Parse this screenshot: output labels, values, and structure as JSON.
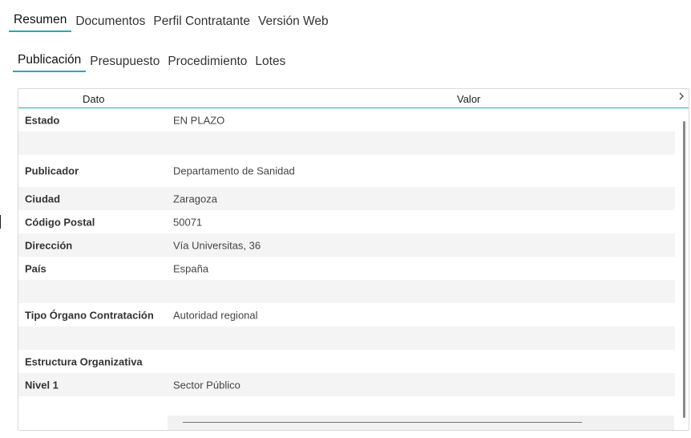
{
  "tabs_top": [
    "Resumen",
    "Documentos",
    "Perfil Contratante",
    "Versión Web"
  ],
  "tabs_sub": [
    "Publicación",
    "Presupuesto",
    "Procedimiento",
    "Lotes"
  ],
  "grid": {
    "header": {
      "col1": "Dato",
      "col2": "Valor"
    },
    "rows": [
      {
        "key": "Estado",
        "value": "EN PLAZO"
      },
      {
        "key": "",
        "value": ""
      },
      {
        "key": "Publicador",
        "value": "Departamento de Sanidad"
      },
      {
        "key": "Ciudad",
        "value": "Zaragoza"
      },
      {
        "key": "Código Postal",
        "value": "50071"
      },
      {
        "key": "Dirección",
        "value": "Vía Universitas, 36"
      },
      {
        "key": "País",
        "value": "España"
      },
      {
        "key": "",
        "value": ""
      },
      {
        "key": "Tipo Órgano Contratación",
        "value": "Autoridad regional"
      },
      {
        "key": "",
        "value": ""
      },
      {
        "key": "Estructura Organizativa",
        "value": ""
      },
      {
        "key": "Nivel 1",
        "value": "Sector Público"
      }
    ]
  },
  "colors": {
    "accent": "#2aa6b8"
  },
  "icons": {
    "scroll_right": "chevron-right-icon"
  }
}
